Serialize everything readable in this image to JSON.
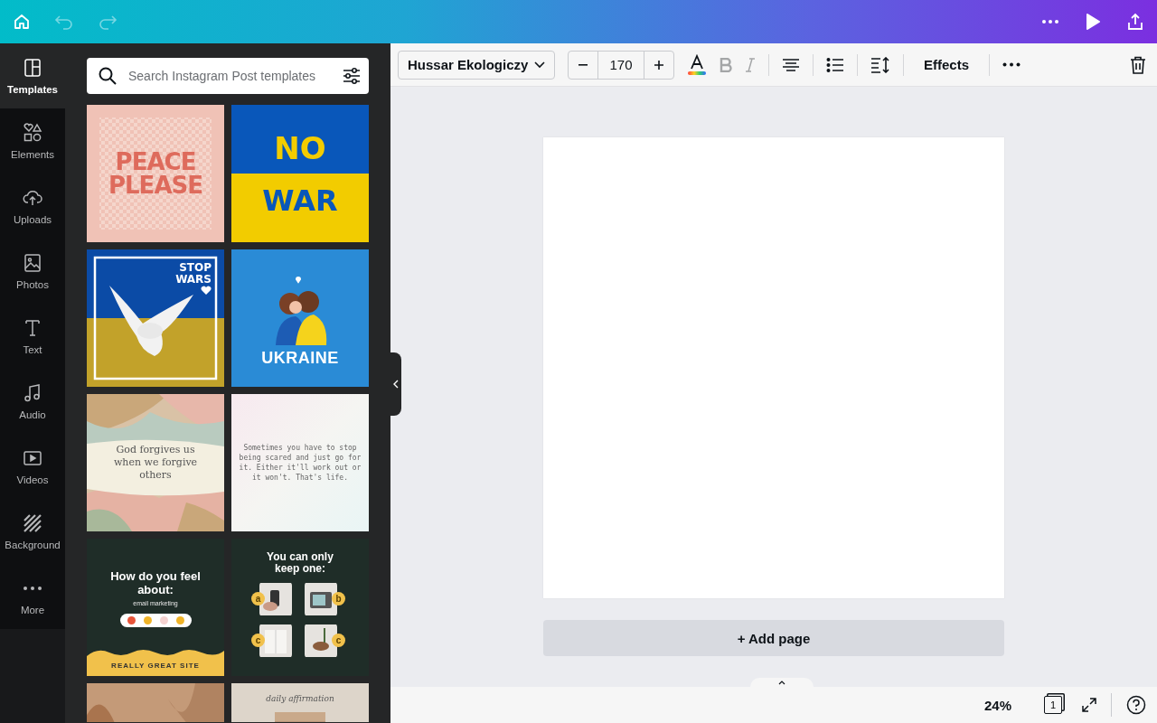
{
  "topbar": {
    "undo": {
      "disabled": true
    },
    "redo": {
      "disabled": true
    }
  },
  "nav": [
    {
      "label": "Templates",
      "selected": true
    },
    {
      "label": "Elements",
      "selected": false
    },
    {
      "label": "Uploads",
      "selected": false
    },
    {
      "label": "Photos",
      "selected": false
    },
    {
      "label": "Text",
      "selected": false
    },
    {
      "label": "Audio",
      "selected": false
    },
    {
      "label": "Videos",
      "selected": false
    },
    {
      "label": "Background",
      "selected": false
    },
    {
      "label": "More",
      "selected": false
    }
  ],
  "search": {
    "placeholder": "Search Instagram Post templates"
  },
  "templates": [
    {
      "kind": "peace",
      "texts": [
        "PEACE",
        "PLEASE"
      ]
    },
    {
      "kind": "flag",
      "texts": [
        "NO",
        "WAR"
      ]
    },
    {
      "kind": "dove",
      "texts": [
        "STOP",
        "WARS"
      ]
    },
    {
      "kind": "hug",
      "texts": [
        "UKRAINE"
      ]
    },
    {
      "kind": "watercolor",
      "texts": [
        "God forgives us when we forgive others"
      ]
    },
    {
      "kind": "quote",
      "texts": [
        "Sometimes you have to stop being scared and just go for it. Either it'll work out or it won't. That's life."
      ]
    },
    {
      "kind": "poll",
      "texts": [
        "How do you feel about:",
        "email marketing",
        "REALLY GREAT SITE"
      ]
    },
    {
      "kind": "choice",
      "texts": [
        "You can only keep one:",
        "a",
        "b",
        "c",
        "c"
      ]
    },
    {
      "kind": "floral"
    },
    {
      "kind": "affirmation",
      "texts": [
        "daily affirmation"
      ]
    }
  ],
  "toolbar": {
    "font": "Hussar Ekologiczy",
    "size": "170",
    "bold": {
      "disabled": true
    },
    "italic": {
      "disabled": true
    },
    "effects": "Effects"
  },
  "canvas": {
    "add_page": "+ Add page"
  },
  "status_bar": {
    "zoom": "24%",
    "page_count": "1"
  }
}
